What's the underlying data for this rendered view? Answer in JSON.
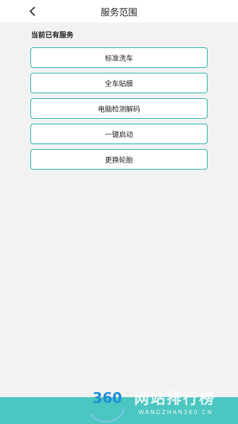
{
  "header": {
    "title": "服务范围",
    "back_icon": "chevron-left-icon"
  },
  "section": {
    "label": "当前已有服务"
  },
  "services": [
    {
      "label": "标准洗车"
    },
    {
      "label": "全车贴膜"
    },
    {
      "label": "电脑检测解码"
    },
    {
      "label": "一键启动"
    },
    {
      "label": "更换轮胎"
    }
  ],
  "watermark": {
    "logo_text": "360",
    "site_name": "网站排行榜",
    "url": "WANGZHAN360.CN"
  },
  "colors": {
    "accent": "#2ab2a8",
    "footer": "#4cc6c0",
    "background": "#f2f2f2"
  }
}
